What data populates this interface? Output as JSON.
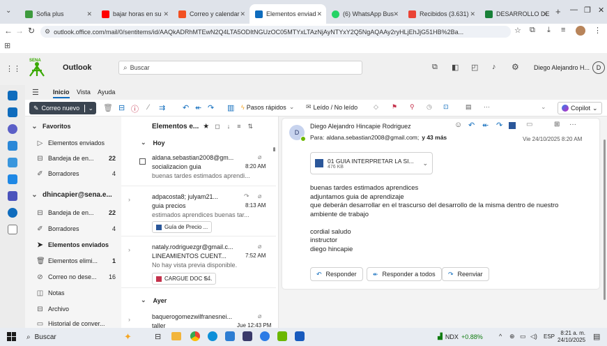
{
  "tabs": [
    {
      "label": "Sofia plus",
      "color": "#3d9a3d",
      "active": false
    },
    {
      "label": "bajar horas en su",
      "color": "#ff0000",
      "active": false
    },
    {
      "label": "Correo y calendar",
      "color": "#f25022",
      "active": false
    },
    {
      "label": "Elementos enviad",
      "color": "#0f6cbd",
      "active": true
    },
    {
      "label": "(6) WhatsApp Bus",
      "color": "#25d366",
      "active": false
    },
    {
      "label": "Recibidos (3.631)",
      "color": "#ea4335",
      "active": false
    },
    {
      "label": "DESARROLLO DE",
      "color": "#188038",
      "active": false
    }
  ],
  "browser": {
    "url": "outlook.office.com/mail/0/sentitems/id/AAQkADRhMTEwN2Q4LTA5ODItNGUzOC05MTYxLTAzNjAyNTYxY2Q5NgAQAAy2ryHLjEhJjG51HB%2Ba..."
  },
  "outlook": {
    "app_name": "Outlook",
    "search_placeholder": "Buscar",
    "user_name": "Diego Alejandro H...",
    "user_initial": "D",
    "ribbon_tabs": [
      "Inicio",
      "Vista",
      "Ayuda"
    ],
    "new_mail": "Correo nuevo",
    "quick_steps": "Pasos rápidos",
    "read_unread": "Leído / No leído",
    "copilot": "Copilot"
  },
  "folders": {
    "favorites_label": "Favoritos",
    "favorites": [
      {
        "name": "Elementos enviados",
        "count": ""
      },
      {
        "name": "Bandeja de en...",
        "count": "22"
      },
      {
        "name": "Borradores",
        "count": "4"
      }
    ],
    "account_label": "dhincapier@sena.e...",
    "account": [
      {
        "name": "Bandeja de en...",
        "count": "22"
      },
      {
        "name": "Borradores",
        "count": "4"
      },
      {
        "name": "Elementos enviados",
        "count": ""
      },
      {
        "name": "Elementos elimi...",
        "count": "1"
      },
      {
        "name": "Correo no dese...",
        "count": "16"
      },
      {
        "name": "Notas",
        "count": ""
      },
      {
        "name": "Archivo",
        "count": ""
      },
      {
        "name": "Historial de conver...",
        "count": ""
      }
    ]
  },
  "list": {
    "header": "Elementos e...",
    "group_today": "Hoy",
    "group_yesterday": "Ayer",
    "messages": [
      {
        "from": "aldana.sebastian2008@gm...",
        "subject": "socializacion guia",
        "time": "8:20 AM",
        "preview": "buenas tardes estimados aprendi...",
        "attachment": "",
        "extra": ""
      },
      {
        "from": "adpacosta8; julyam21...",
        "subject": "guia precios",
        "time": "8:13 AM",
        "preview": "estimados aprendices buenas tar...",
        "attachment": "Guía de Precio ...",
        "extra": ""
      },
      {
        "from": "nataly.rodriguezgr@gmail.c...",
        "subject": "LINEAMIENTOS CUENT...",
        "time": "7:52 AM",
        "preview": "No hay vista previa disponible.",
        "attachment": "CARGUE DOC S...",
        "extra": "+4"
      },
      {
        "from": "baquerogomezwilfranesnei...",
        "subject": "taller",
        "time": "Jue 12:43 PM",
        "preview": "",
        "attachment": "",
        "extra": ""
      }
    ]
  },
  "reading": {
    "avatar": "D",
    "sender": "Diego Alejandro Hincapie Rodriguez",
    "to_label": "Para:",
    "to": "aldana.sebastian2008@gmail.com;",
    "more": "y 43 más",
    "date": "Vie 24/10/2025 8:20 AM",
    "attachment_name": "01 GUIA INTERPRETAR LA SI...",
    "attachment_size": "476 KB",
    "body": [
      "buenas tardes estimados aprendices",
      "adjuntamos guia de aprendizaje",
      "que deberán desarrollar en el trascurso del desarrollo de la misma dentro de nuestro",
      "ambiente de trabajo",
      "",
      "cordial saludo",
      "instructor",
      "diego hincapie"
    ],
    "reply": "Responder",
    "reply_all": "Responder a todos",
    "forward": "Reenviar"
  },
  "taskbar": {
    "search": "Buscar",
    "stock_name": "NDX",
    "stock_change": "+0.88%",
    "lang": "ESP",
    "time": "8:21 a. m.",
    "date": "24/10/2025"
  }
}
